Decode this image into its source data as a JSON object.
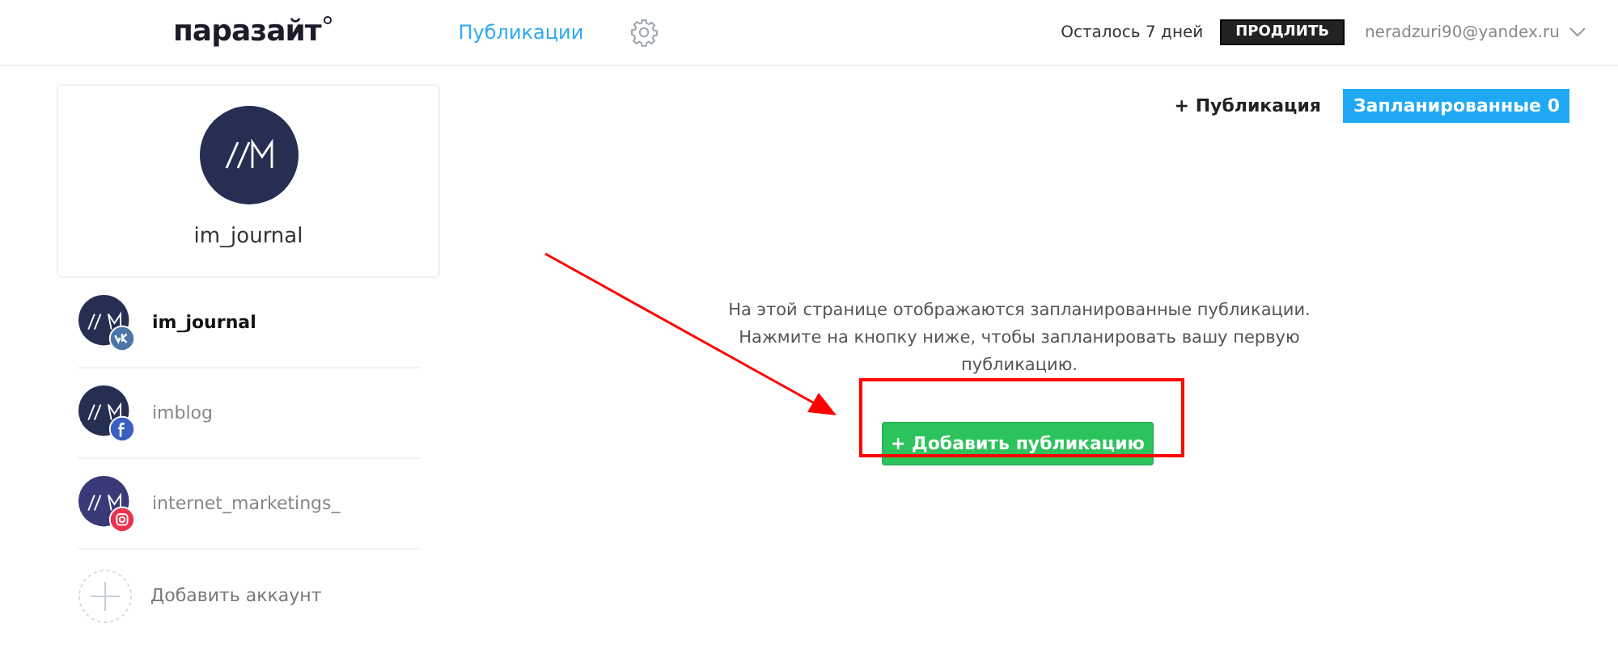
{
  "header": {
    "logo": "паразайт",
    "nav": [
      {
        "label": "Публикации",
        "selected": true
      }
    ],
    "trial": "Осталось 7 дней",
    "extend_button": "ПРОДЛИТЬ",
    "account": "neradzuri90@yandex.ru"
  },
  "profile": {
    "name": "im_journal"
  },
  "accounts": [
    {
      "name": "im_journal",
      "kind": "vk",
      "selected": true
    },
    {
      "name": "imblog",
      "kind": "facebook",
      "selected": false
    },
    {
      "name": "internet_marketings_",
      "kind": "instagram",
      "selected": false
    }
  ],
  "add_account": "Добавить аккаунт",
  "toolbar": {
    "new_post": "+ Публикация",
    "scheduled": "Запланированные 0"
  },
  "empty_state": {
    "message": "На этой странице отображаются запланированные публикации. Нажмите на кнопку ниже, чтобы запланировать вашу первую публикацию.",
    "button": "+ Добавить публикацию"
  }
}
